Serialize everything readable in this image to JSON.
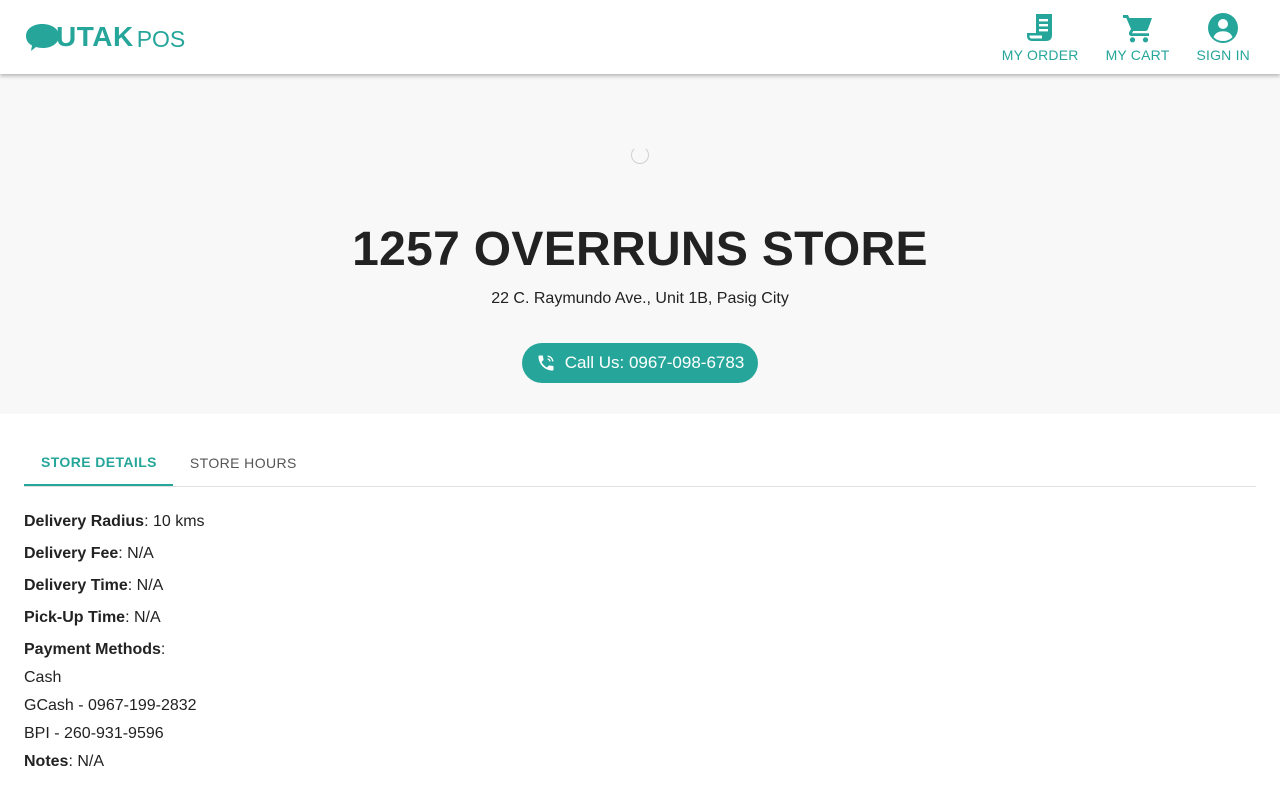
{
  "colors": {
    "brand": "#26a69a",
    "text": "#222222",
    "hero_bg": "#f8f8f8"
  },
  "header": {
    "logo": {
      "utak": "UTAK",
      "pos": "POS"
    },
    "nav": [
      {
        "label": "MY ORDER",
        "icon": "receipt-icon"
      },
      {
        "label": "MY CART",
        "icon": "cart-icon"
      },
      {
        "label": "SIGN IN",
        "icon": "account-circle-icon"
      }
    ]
  },
  "hero": {
    "store_name": "1257 OVERRUNS STORE",
    "address": "22 C. Raymundo Ave., Unit 1B, Pasig City",
    "call_label": "Call Us: 0967-098-6783",
    "call_icon": "phone-icon"
  },
  "tabs": [
    {
      "label": "STORE DETAILS",
      "active": true
    },
    {
      "label": "STORE HOURS",
      "active": false
    }
  ],
  "details": {
    "delivery_radius": {
      "label": "Delivery Radius",
      "value": ": 10 kms"
    },
    "delivery_fee": {
      "label": "Delivery Fee",
      "value": ": N/A"
    },
    "delivery_time": {
      "label": "Delivery Time",
      "value": ": N/A"
    },
    "pickup_time": {
      "label": "Pick-Up Time",
      "value": ": N/A"
    },
    "payment_methods": {
      "label": "Payment Methods",
      "value": ":"
    },
    "payment_list": [
      "Cash",
      "GCash - 0967-199-2832",
      "BPI - 260-931-9596"
    ],
    "notes": {
      "label": "Notes",
      "value": ": N/A"
    }
  }
}
